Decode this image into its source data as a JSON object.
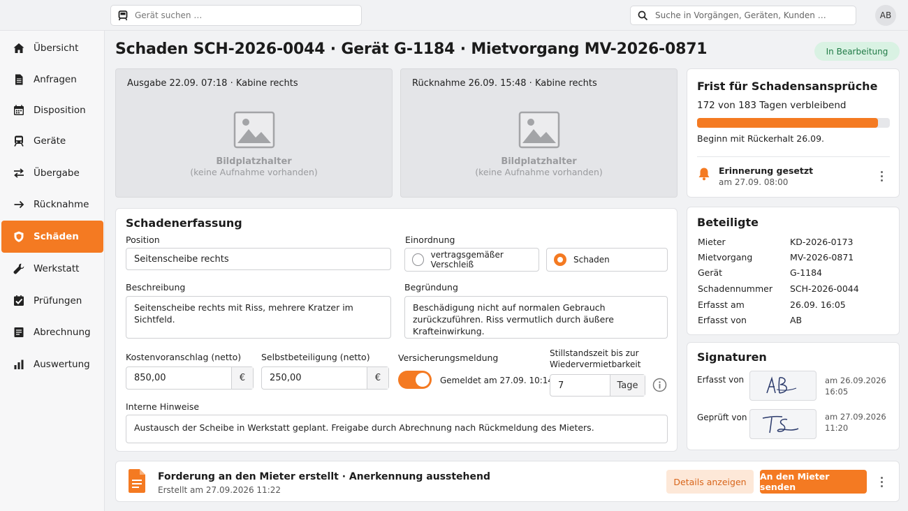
{
  "topbar": {
    "device_search_placeholder": "Gerät suchen …",
    "global_search_placeholder": "Suche in Vorgängen, Geräten, Kunden …",
    "user_initials": "AB"
  },
  "sidebar": {
    "items": [
      {
        "label": "Übersicht",
        "icon": "home-icon"
      },
      {
        "label": "Anfragen",
        "icon": "document-icon"
      },
      {
        "label": "Disposition",
        "icon": "calendar-icon"
      },
      {
        "label": "Geräte",
        "icon": "train-icon"
      },
      {
        "label": "Übergabe",
        "icon": "swap-icon"
      },
      {
        "label": "Rücknahme",
        "icon": "arrow-right-icon"
      },
      {
        "label": "Schäden",
        "icon": "shield-icon",
        "active": true
      },
      {
        "label": "Werkstatt",
        "icon": "wrench-icon"
      },
      {
        "label": "Prüfungen",
        "icon": "checkbox-icon"
      },
      {
        "label": "Abrechnung",
        "icon": "invoice-icon"
      },
      {
        "label": "Auswertung",
        "icon": "bar-chart-icon"
      }
    ]
  },
  "header": {
    "title": "Schaden SCH-2026-0044 · Gerät G-1184 · Mietvorgang MV-2026-0871",
    "status": "In Bearbeitung"
  },
  "photos": [
    {
      "caption": "Ausgabe 22.09. 07:18 · Kabine rechts",
      "placeholder_title": "Bildplatzhalter",
      "placeholder_sub": "(keine Aufnahme vorhanden)"
    },
    {
      "caption": "Rücknahme 26.09. 15:48 · Kabine rechts",
      "placeholder_title": "Bildplatzhalter",
      "placeholder_sub": "(keine Aufnahme vorhanden)"
    }
  ],
  "form": {
    "title": "Schadenerfassung",
    "position_label": "Position",
    "position_value": "Seitenscheibe rechts",
    "classification_label": "Einordnung",
    "classification_options": [
      "vertragsgemäßer Verschleiß",
      "Schaden"
    ],
    "classification_selected": "Schaden",
    "description_label": "Beschreibung",
    "description_value": "Seitenscheibe rechts mit Riss, mehrere Kratzer im Sichtfeld.",
    "reason_label": "Begründung",
    "reason_value": "Beschädigung nicht auf normalen Gebrauch zurückzuführen. Riss vermutlich durch äußere Krafteinwirkung.",
    "cost_label": "Kostenvoranschlag (netto)",
    "cost_value": "850,00",
    "cost_unit": "€",
    "deductible_label": "Selbstbeteiligung (netto)",
    "deductible_value": "250,00",
    "deductible_unit": "€",
    "insurance_label": "Versicherungsmeldung",
    "insurance_on": true,
    "insurance_status": "Gemeldet am 27.09. 10:14",
    "downtime_label_1": "Stillstandszeit bis zur",
    "downtime_label_2": "Wiedervermietbarkeit",
    "downtime_value": "7",
    "downtime_unit": "Tage",
    "notes_label": "Interne Hinweise",
    "notes_value": "Austausch der Scheibe in Werkstatt geplant. Freigabe durch Abrechnung nach Rückmeldung des Mieters."
  },
  "deadline": {
    "title": "Frist für Schadensansprüche",
    "remaining_text": "172 von 183 Tagen verbleibend",
    "progress_fraction": 0.94,
    "start_text": "Beginn mit Rückerhalt 26.09.",
    "reminder_title": "Erinnerung gesetzt",
    "reminder_time": "am 27.09. 08:00"
  },
  "parties": {
    "title": "Beteiligte",
    "rows": [
      {
        "key": "Mieter",
        "value": "KD-2026-0173"
      },
      {
        "key": "Mietvorgang",
        "value": "MV-2026-0871"
      },
      {
        "key": "Gerät",
        "value": "G-1184"
      },
      {
        "key": "Schadennummer",
        "value": "SCH-2026-0044"
      },
      {
        "key": "Erfasst am",
        "value": "26.09. 16:05"
      },
      {
        "key": "Erfasst von",
        "value": "AB"
      }
    ]
  },
  "signatures": {
    "title": "Signaturen",
    "rows": [
      {
        "label": "Erfasst von",
        "signature": "AB",
        "date": "am 26.09.2026",
        "time": "16:05"
      },
      {
        "label": "Geprüft von",
        "signature": "TS",
        "date": "am 27.09.2026",
        "time": "11:20"
      }
    ]
  },
  "footer": {
    "title": "Forderung an den Mieter erstellt · Anerkennung ausstehend",
    "subtitle": "Erstellt am 27.09.2026 11:22",
    "details_button": "Details anzeigen",
    "send_button": "An den Mieter senden"
  },
  "colors": {
    "accent": "#f47a22",
    "status_bg": "#d9f2e3",
    "status_text": "#1f7a45"
  }
}
